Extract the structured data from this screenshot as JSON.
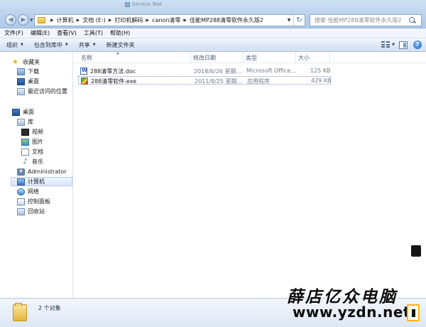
{
  "window": {
    "ghost_title": "Service Tool"
  },
  "address": {
    "crumbs": [
      "计算机",
      "文档 (E:)",
      "打印机解码",
      "canon清零",
      "佳能MP288清零软件永久版2"
    ],
    "search_placeholder": "搜索 佳能MP288清零软件永久版2"
  },
  "menu": [
    "文件(F)",
    "编辑(E)",
    "查看(V)",
    "工具(T)",
    "帮助(H)"
  ],
  "toolbar": {
    "organize": "组织",
    "include_in_library": "包含到库中",
    "share": "共享",
    "new_folder": "新建文件夹"
  },
  "nav": {
    "favorites": "收藏夹",
    "downloads": "下载",
    "desktop_fav": "桌面",
    "recent": "最近访问的位置",
    "desktop": "桌面",
    "library": "库",
    "videos": "视频",
    "pictures": "图片",
    "documents": "文档",
    "music": "音乐",
    "administrator": "Administrator",
    "computer": "计算机",
    "network": "网络",
    "control_panel": "控制面板",
    "recycle_bin": "回收站"
  },
  "columns": {
    "name": "名称",
    "modified": "修改日期",
    "type": "类型",
    "size": "大小"
  },
  "files": [
    {
      "name": "288清零方法.doc",
      "modified": "2018/6/26 星期...",
      "type": "Microsoft Office...",
      "size": "125 KB",
      "icon": "word-doc-icon"
    },
    {
      "name": "288清零软件.exe",
      "modified": "2011/8/25 星期...",
      "type": "应用程序",
      "size": "429 KB",
      "icon": "exe-app-icon"
    }
  ],
  "status": {
    "count": "2 个对象"
  },
  "watermark": {
    "title": "薛店亿众电脑",
    "url": "www.yzdn.net"
  }
}
